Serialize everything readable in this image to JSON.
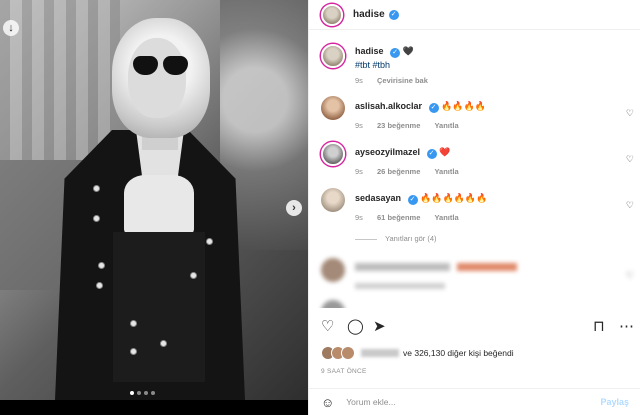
{
  "post": {
    "username": "hadise",
    "caption_suffix": "🖤",
    "tags": "#tbt #tbh",
    "caption_time": "9s",
    "translate_label": "Çevirisine bak"
  },
  "comments": [
    {
      "user": "aslisah.alkoclar",
      "text": "🔥🔥🔥🔥",
      "time": "9s",
      "likes": "23 beğenme",
      "reply": "Yanıtla"
    },
    {
      "user": "ayseozyilmazel",
      "text": "❤️",
      "time": "9s",
      "likes": "26 beğenme",
      "reply": "Yanıtla"
    },
    {
      "user": "sedasayan",
      "text": "🔥🔥🔥🔥🔥🔥",
      "time": "9s",
      "likes": "61 beğenme",
      "reply": "Yanıtla"
    }
  ],
  "view_replies": "Yanıtları gör (4)",
  "likes_text": "ve 326,130 diğer kişi beğendi",
  "post_time": "9 SAAT ÖNCE",
  "comment_placeholder": "Yorum ekle...",
  "post_button": "Paylaş",
  "colors": {
    "accent": "#3897f0",
    "link": "#00376b",
    "muted": "#8e8e8e"
  }
}
